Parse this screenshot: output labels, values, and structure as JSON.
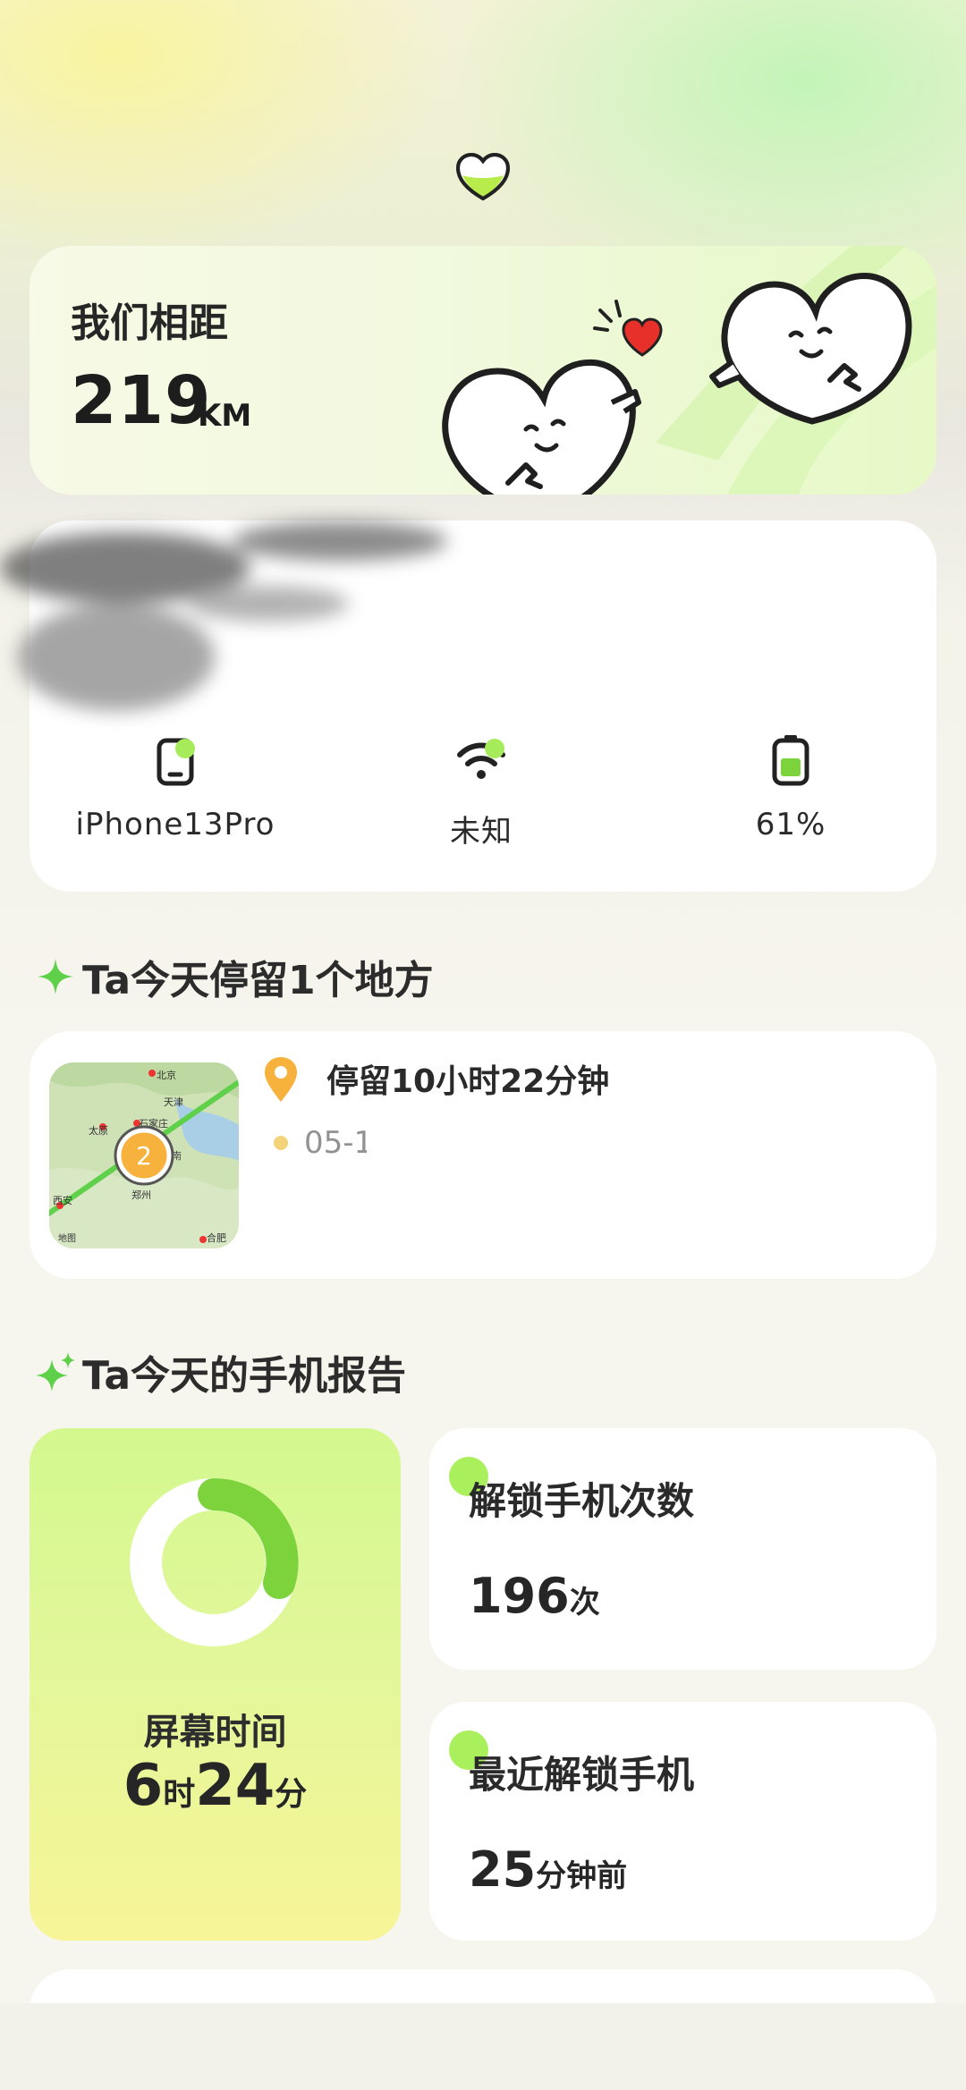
{
  "distance": {
    "label": "我们相距",
    "value": "219",
    "unit": "KM"
  },
  "device": {
    "model": "iPhone13Pro",
    "network": "未知",
    "battery": "61%"
  },
  "places": {
    "title": "Ta今天停留1个地方",
    "map_marker": "2",
    "stay_duration": "停留10小时22分钟",
    "date": "05-1",
    "map_labels": {
      "beijing": "北京",
      "tianjin": "天津",
      "shijiazhuang": "石家庄",
      "taiyuan": "太原",
      "jinan": "济南",
      "zhengzhou": "郑州",
      "xian": "西安",
      "hefei": "合肥",
      "attribution": "地图"
    }
  },
  "report": {
    "title": "Ta今天的手机报告",
    "screen_time": {
      "label": "屏幕时间",
      "hours": "6",
      "hours_unit": "时",
      "minutes": "24",
      "minutes_unit": "分"
    },
    "unlock_count": {
      "label": "解锁手机次数",
      "value": "196",
      "unit": "次"
    },
    "last_unlock": {
      "label": "最近解锁手机",
      "value": "25",
      "unit": "分钟前"
    }
  },
  "colors": {
    "accent_green": "#a6ec5a",
    "ring_green": "#7dd33b",
    "pin_orange": "#f6b23c",
    "heart_red": "#e8302a"
  }
}
